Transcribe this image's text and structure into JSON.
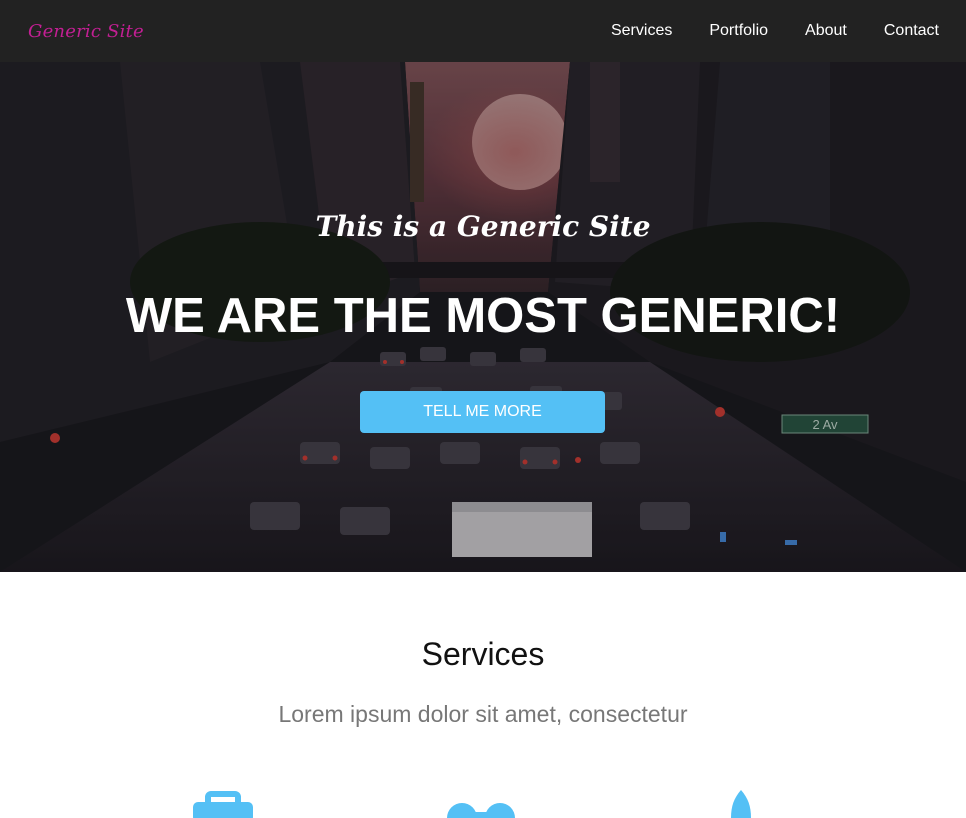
{
  "nav": {
    "brand": "Generic Site",
    "links": [
      "Services",
      "Portfolio",
      "About",
      "Contact"
    ]
  },
  "hero": {
    "subheading": "This is a Generic Site",
    "heading": "WE ARE THE MOST GENERIC!",
    "button_label": "TELL ME MORE",
    "background_image": "city-street-sunset",
    "sign_text": "2 Av"
  },
  "services": {
    "heading": "Services",
    "subheading": "Lorem ipsum dolor sit amet, consectetur",
    "icons": [
      "briefcase-icon",
      "glasses-icon",
      "rocket-icon"
    ]
  },
  "colors": {
    "navbar_bg": "#222222",
    "brand": "#c21f93",
    "accent": "#54c0f5",
    "muted_text": "#777777"
  }
}
